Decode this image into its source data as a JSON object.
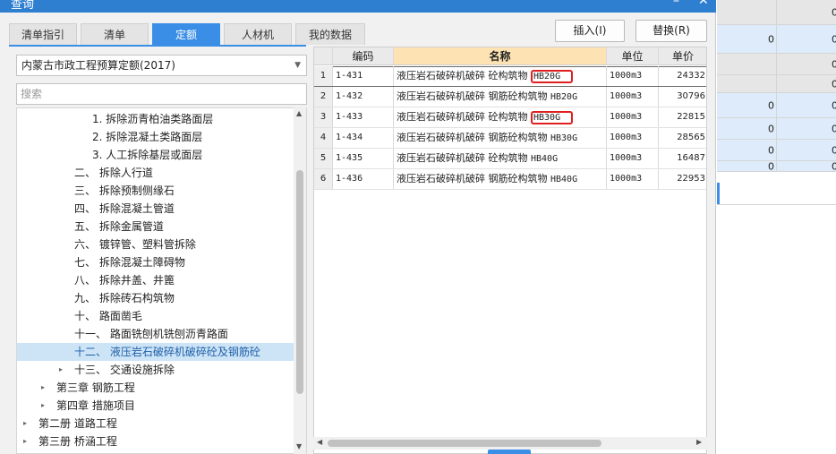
{
  "dialog": {
    "title": "查询",
    "minimize": "–",
    "close": "✕"
  },
  "tabs": [
    "清单指引",
    "清单",
    "定额",
    "人材机",
    "我的数据"
  ],
  "active_tab": 2,
  "actions": {
    "insert": "插入(I)",
    "replace": "替换(R)"
  },
  "library": {
    "selected": "内蒙古市政工程预算定额(2017)"
  },
  "search": {
    "placeholder": "搜索"
  },
  "tree": [
    {
      "label": "1. 拆除沥青柏油类路面层",
      "indent": 84,
      "toggle": ""
    },
    {
      "label": "2. 拆除混凝土类路面层",
      "indent": 84,
      "toggle": ""
    },
    {
      "label": "3. 人工拆除基层或面层",
      "indent": 84,
      "toggle": ""
    },
    {
      "label": "二、 拆除人行道",
      "indent": 64,
      "toggle": ""
    },
    {
      "label": "三、 拆除预制侧缘石",
      "indent": 64,
      "toggle": ""
    },
    {
      "label": "四、 拆除混凝土管道",
      "indent": 64,
      "toggle": ""
    },
    {
      "label": "五、 拆除金属管道",
      "indent": 64,
      "toggle": ""
    },
    {
      "label": "六、 镀锌管、塑料管拆除",
      "indent": 64,
      "toggle": ""
    },
    {
      "label": "七、 拆除混凝土障碍物",
      "indent": 64,
      "toggle": ""
    },
    {
      "label": "八、 拆除井盖、井篦",
      "indent": 64,
      "toggle": ""
    },
    {
      "label": "九、 拆除砖石构筑物",
      "indent": 64,
      "toggle": ""
    },
    {
      "label": "十、 路面凿毛",
      "indent": 64,
      "toggle": ""
    },
    {
      "label": "十一、 路面铣刨机铣刨沥青路面",
      "indent": 64,
      "toggle": ""
    },
    {
      "label": "十二、 液压岩石破碎机破碎砼及钢筋砼",
      "indent": 64,
      "toggle": "",
      "selected": true
    },
    {
      "label": "十三、 交通设施拆除",
      "indent": 64,
      "toggle": "▸"
    },
    {
      "label": "第三章 钢筋工程",
      "indent": 44,
      "toggle": "▸"
    },
    {
      "label": "第四章 措施项目",
      "indent": 44,
      "toggle": "▸"
    },
    {
      "label": "第二册 道路工程",
      "indent": 24,
      "toggle": "▸"
    },
    {
      "label": "第三册 桥涵工程",
      "indent": 24,
      "toggle": "▸"
    },
    {
      "label": "第四册 隧道工程",
      "indent": 24,
      "toggle": "▸"
    }
  ],
  "grid": {
    "columns": [
      "编码",
      "名称",
      "单位",
      "单价"
    ],
    "rows": [
      {
        "idx": "1",
        "code": "1-431",
        "name": "液压岩石破碎机破碎 砼构筑物",
        "spec": "HB20G",
        "unit": "1000m3",
        "price": "24332",
        "boxed": true,
        "current": true
      },
      {
        "idx": "2",
        "code": "1-432",
        "name": "液压岩石破碎机破碎 钢筋砼构筑物",
        "spec": "HB20G",
        "unit": "1000m3",
        "price": "30796"
      },
      {
        "idx": "3",
        "code": "1-433",
        "name": "液压岩石破碎机破碎 砼构筑物",
        "spec": "HB30G",
        "unit": "1000m3",
        "price": "22815",
        "boxed": true
      },
      {
        "idx": "4",
        "code": "1-434",
        "name": "液压岩石破碎机破碎 钢筋砼构筑物",
        "spec": "HB30G",
        "unit": "1000m3",
        "price": "28565"
      },
      {
        "idx": "5",
        "code": "1-435",
        "name": "液压岩石破碎机破碎 砼构筑物",
        "spec": "HB40G",
        "unit": "1000m3",
        "price": "16487"
      },
      {
        "idx": "6",
        "code": "1-436",
        "name": "液压岩石破碎机破碎 钢筋砼构筑物",
        "spec": "HB40G",
        "unit": "1000m3",
        "price": "22953"
      }
    ]
  },
  "background": {
    "rows": [
      {
        "v": "",
        "v2": "0",
        "color": "#e6e6e6",
        "h": 28
      },
      {
        "v": "0",
        "v2": "0",
        "color": "#deebfa",
        "h": 32
      },
      {
        "v": "",
        "v2": "0",
        "color": "#e6e6e6",
        "h": 24
      },
      {
        "v": "",
        "v2": "0",
        "color": "#e6e6e6",
        "h": 20
      },
      {
        "v": "0",
        "v2": "0",
        "color": "#deebfa",
        "h": 28
      },
      {
        "v": "0",
        "v2": "0",
        "color": "#deebfa",
        "h": 24
      },
      {
        "v": "0",
        "v2": "0",
        "color": "#deebfa",
        "h": 24
      },
      {
        "v": "0",
        "v2": "0",
        "color": "#deebfa",
        "h": 12
      }
    ]
  },
  "colors": {
    "accent": "#3a8ee6",
    "title_bar": "#2f7fd1",
    "highlight_box": "#e02020",
    "selected_tree": "#cde4f7"
  }
}
